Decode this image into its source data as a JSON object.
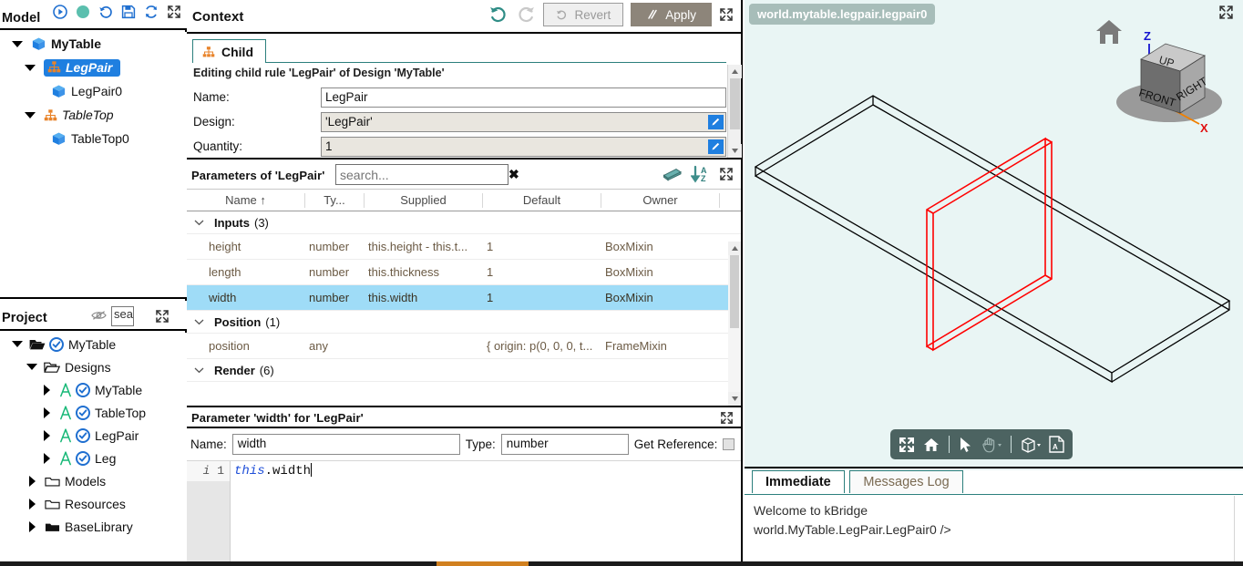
{
  "model_panel": {
    "title": "Model",
    "toolbar": [
      {
        "name": "run-icon",
        "label": "Run"
      },
      {
        "name": "status-dot-icon",
        "label": "Status",
        "color": "#5bbfae"
      },
      {
        "name": "history-icon",
        "label": "History"
      },
      {
        "name": "save-icon",
        "label": "Save"
      },
      {
        "name": "refresh-icon",
        "label": "Refresh"
      },
      {
        "name": "expand-icon",
        "label": "Expand"
      }
    ],
    "tree": [
      {
        "label": "MyTable",
        "indent": 0,
        "caret": "down",
        "icon": "cube-icon",
        "style": "bold",
        "selected": false
      },
      {
        "label": "LegPair",
        "indent": 1,
        "caret": "down",
        "icon": "nodes-icon",
        "style": "italic",
        "selected": true
      },
      {
        "label": "LegPair0",
        "indent": 2,
        "caret": "none",
        "icon": "cube-icon",
        "style": "normal",
        "selected": false
      },
      {
        "label": "TableTop",
        "indent": 1,
        "caret": "down",
        "icon": "nodes-icon",
        "style": "italic",
        "selected": false
      },
      {
        "label": "TableTop0",
        "indent": 2,
        "caret": "none",
        "icon": "cube-icon",
        "style": "normal",
        "selected": false
      }
    ]
  },
  "project_panel": {
    "title": "Project",
    "search_value": "sea",
    "search_placeholder": "search...",
    "tree": [
      {
        "label": "MyTable",
        "indent": 0,
        "caret": "down",
        "icon": "folder-open-filled-icon",
        "badge": "check-circle-icon"
      },
      {
        "label": "Designs",
        "indent": 1,
        "caret": "down",
        "icon": "folder-open-icon",
        "badge": ""
      },
      {
        "label": "MyTable",
        "indent": 2,
        "caret": "right",
        "icon": "design-A-icon",
        "badge": "check-circle-icon"
      },
      {
        "label": "TableTop",
        "indent": 2,
        "caret": "right",
        "icon": "design-A-icon",
        "badge": "check-circle-icon"
      },
      {
        "label": "LegPair",
        "indent": 2,
        "caret": "right",
        "icon": "design-A-icon",
        "badge": "check-circle-icon"
      },
      {
        "label": "Leg",
        "indent": 2,
        "caret": "right",
        "icon": "design-A-icon",
        "badge": "check-circle-icon"
      },
      {
        "label": "Models",
        "indent": 1,
        "caret": "right",
        "icon": "folder-icon",
        "badge": ""
      },
      {
        "label": "Resources",
        "indent": 1,
        "caret": "right",
        "icon": "folder-icon",
        "badge": ""
      },
      {
        "label": "BaseLibrary",
        "indent": 1,
        "caret": "right",
        "icon": "folder-filled-icon",
        "badge": ""
      }
    ]
  },
  "context": {
    "title": "Context",
    "undo_label": "Undo",
    "redo_label": "Redo",
    "revert_label": "Revert",
    "apply_label": "Apply",
    "tab_label": "Child",
    "subtitle": "Editing child rule 'LegPair' of Design 'MyTable'",
    "fields": [
      {
        "label": "Name:",
        "value": "LegPair",
        "readonly": false,
        "pencil": false
      },
      {
        "label": "Design:",
        "value": "'LegPair'",
        "readonly": true,
        "pencil": true
      },
      {
        "label": "Quantity:",
        "value": "1",
        "readonly": true,
        "pencil": true
      }
    ]
  },
  "parameters": {
    "title": "Parameters of 'LegPair'",
    "search_value": "",
    "search_placeholder": "search...",
    "clear_label": "✖",
    "columns": [
      "Name",
      "Ty...",
      "Supplied",
      "Default",
      "Owner"
    ],
    "sort_indicator": "↑",
    "rows": [
      {
        "kind": "group",
        "label": "Inputs",
        "count": "(3)"
      },
      {
        "kind": "row",
        "name": "height",
        "type": "number",
        "supplied": "this.height - this.t...",
        "default": "1",
        "owner": "BoxMixin",
        "selected": false
      },
      {
        "kind": "row",
        "name": "length",
        "type": "number",
        "supplied": "this.thickness",
        "default": "1",
        "owner": "BoxMixin",
        "selected": false
      },
      {
        "kind": "row",
        "name": "width",
        "type": "number",
        "supplied": "this.width",
        "default": "1",
        "owner": "BoxMixin",
        "selected": true
      },
      {
        "kind": "group",
        "label": "Position",
        "count": "(1)"
      },
      {
        "kind": "row",
        "name": "position",
        "type": "any",
        "supplied": "",
        "default": "{ origin: p(0, 0, 0, t...",
        "owner": "FrameMixin",
        "selected": false
      },
      {
        "kind": "group",
        "label": "Render",
        "count": "(6)"
      }
    ]
  },
  "param_editor": {
    "title": "Parameter 'width' for 'LegPair'",
    "name_label": "Name:",
    "name_value": "width",
    "type_label": "Type:",
    "type_value": "number",
    "get_reference_label": "Get Reference:",
    "gutter_mark": "i",
    "line_number": "1",
    "code_keyword": "this",
    "code_rest": ".width"
  },
  "viewport": {
    "breadcrumb": "world.mytable.legpair.legpair0",
    "navcube": {
      "top_face": "UP",
      "left_face": "FRONT",
      "right_face": "RIGHT",
      "axis_z": "Z",
      "axis_x": "X",
      "axis_z_color": "#1414d0",
      "axis_x_color": "#e01010",
      "home_label": "Home"
    },
    "toolbar": [
      {
        "name": "fit-to-view-icon",
        "label": "Fit to view"
      },
      {
        "name": "home-icon",
        "label": "Home view"
      },
      {
        "name": "separator",
        "label": ""
      },
      {
        "name": "select-cursor-icon",
        "label": "Select"
      },
      {
        "name": "pan-hand-icon",
        "label": "Pan"
      },
      {
        "name": "separator",
        "label": ""
      },
      {
        "name": "view-box-icon",
        "label": "View mode"
      },
      {
        "name": "export-pdf-icon",
        "label": "Export PDF"
      }
    ],
    "geometry": {
      "tabletop_color": "#000000",
      "legpair_color": "#ff0000",
      "background_color": "#e9f5f4"
    }
  },
  "console": {
    "tabs": [
      {
        "label": "Immediate",
        "active": true
      },
      {
        "label": "Messages Log",
        "active": false
      }
    ],
    "lines": [
      "Welcome to kBridge",
      "world.MyTable.LegPair.LegPair0 />"
    ]
  },
  "accent_color": "#d1801f"
}
